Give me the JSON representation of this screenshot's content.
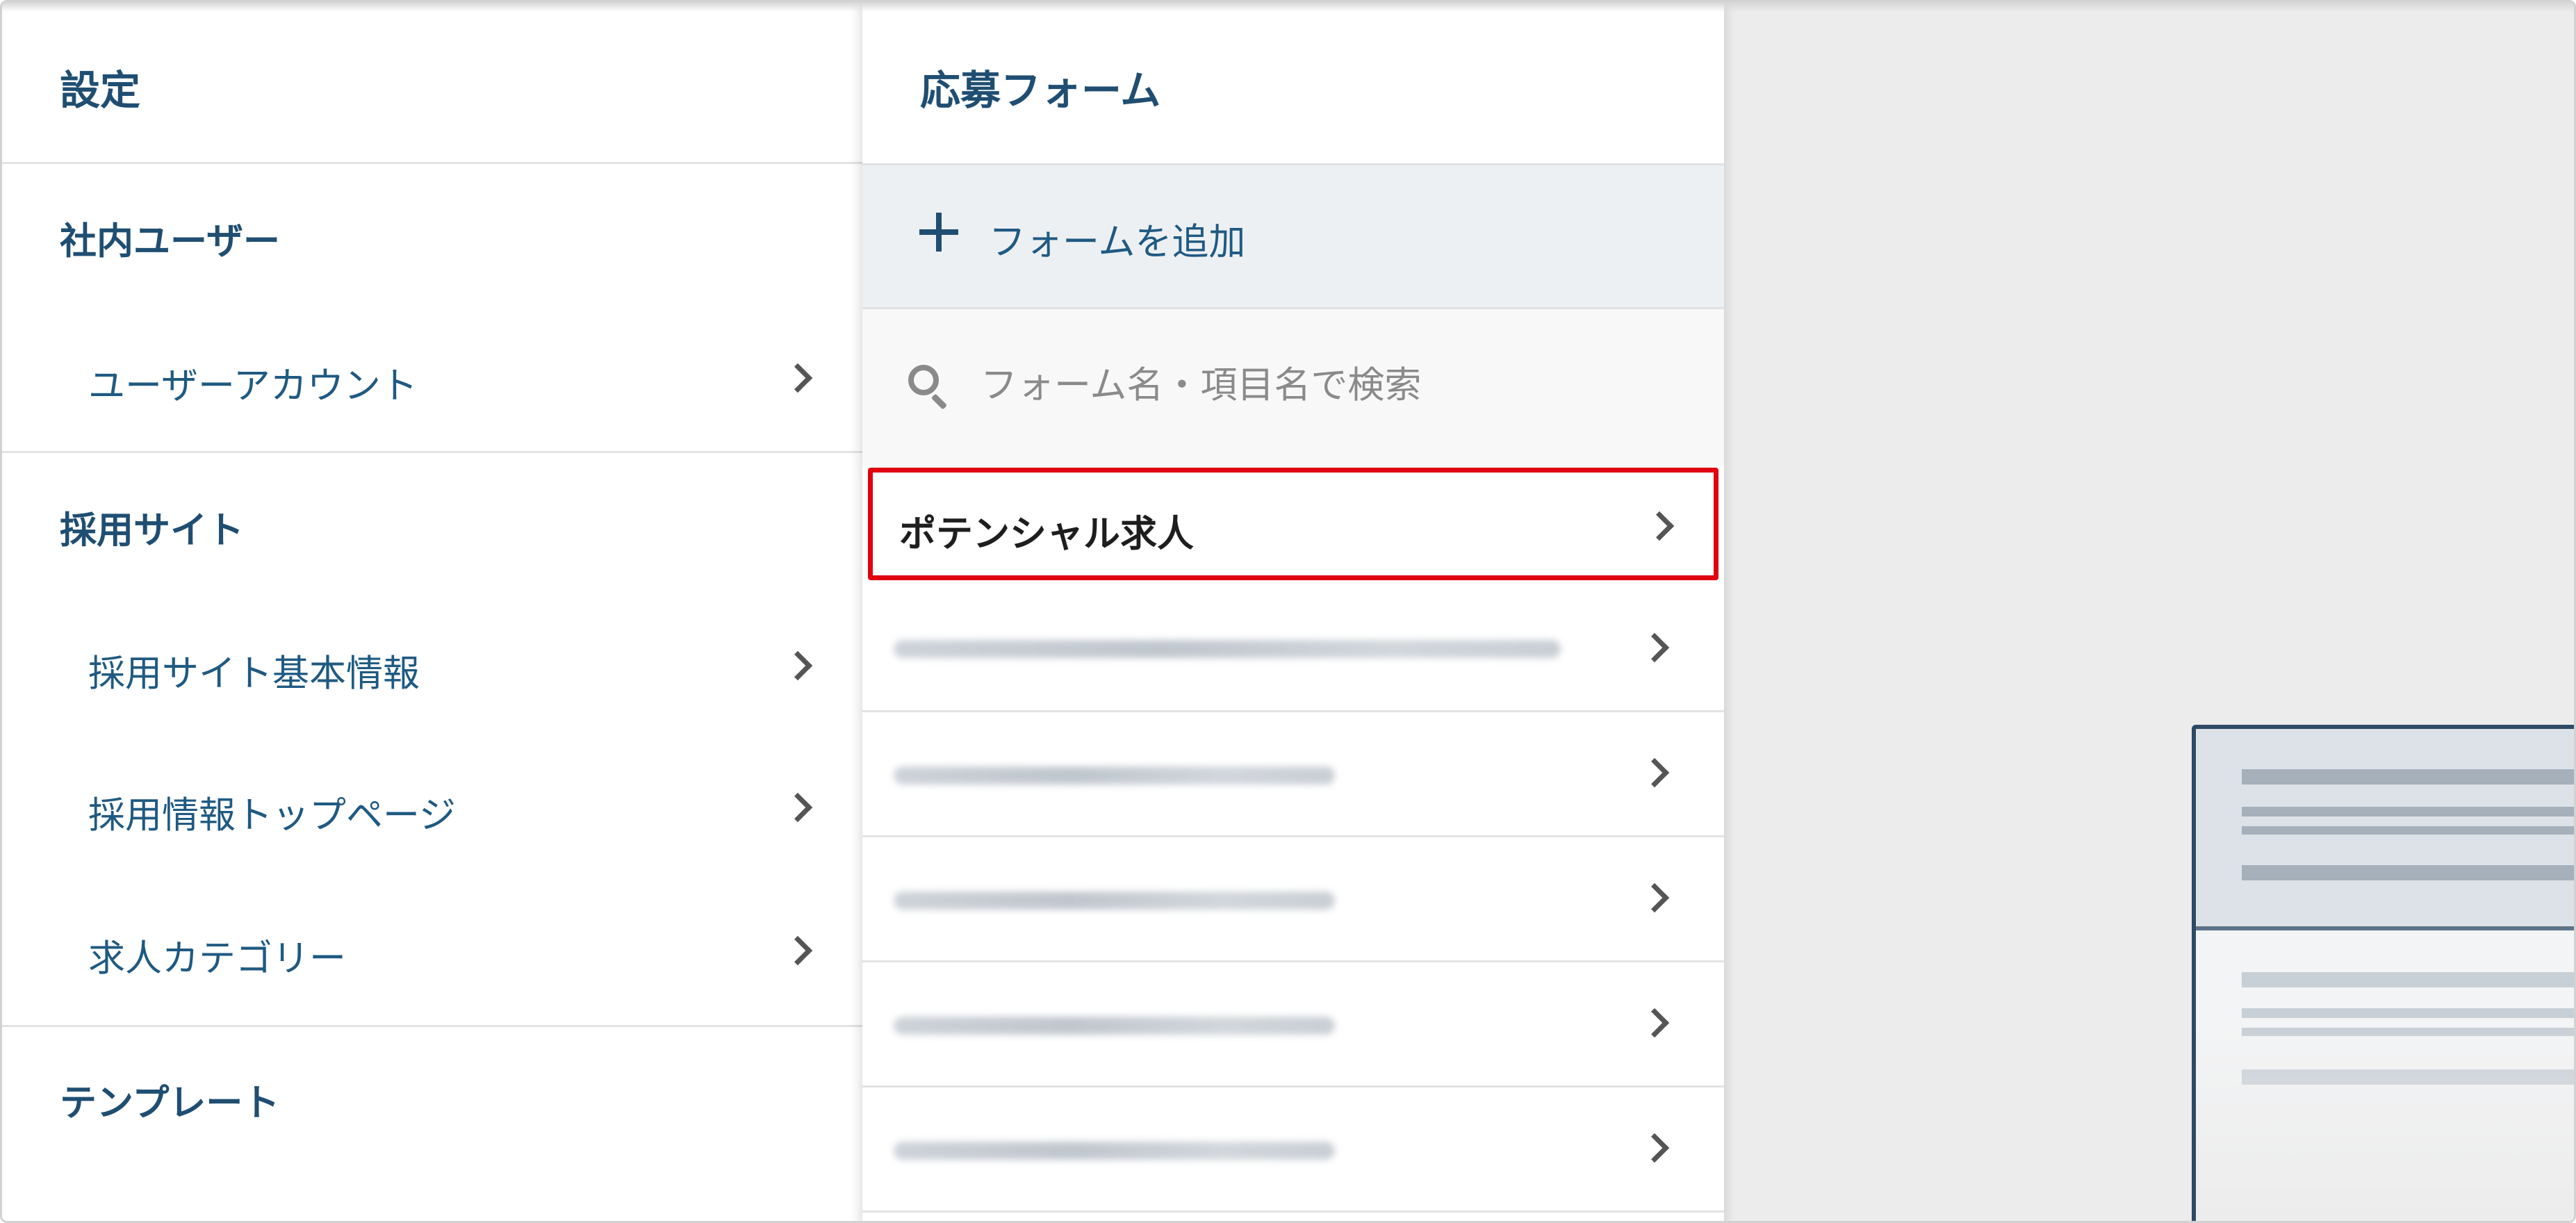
{
  "settings_panel": {
    "title": "設定",
    "sections": [
      {
        "label": "社内ユーザー",
        "items": [
          {
            "label": "ユーザーアカウント"
          }
        ]
      },
      {
        "label": "採用サイト",
        "items": [
          {
            "label": "採用サイト基本情報"
          },
          {
            "label": "採用情報トップページ"
          },
          {
            "label": "求人カテゴリー"
          }
        ]
      },
      {
        "label": "テンプレート",
        "items": []
      }
    ]
  },
  "form_panel": {
    "title": "応募フォーム",
    "add_label": "フォームを追加",
    "search": {
      "placeholder": "フォーム名・項目名で検索",
      "value": ""
    },
    "forms": [
      {
        "name": "ポテンシャル求人",
        "highlighted": true
      },
      {
        "name": "",
        "blurred": true
      },
      {
        "name": "",
        "blurred": true
      },
      {
        "name": "",
        "blurred": true
      },
      {
        "name": "",
        "blurred": true
      },
      {
        "name": "",
        "blurred": true
      }
    ]
  },
  "colors": {
    "heading": "#1f4e72",
    "highlight_border": "#e0000f",
    "add_row_bg": "#edf0f3",
    "preview_bg": "#ececec"
  },
  "icons": [
    "plus-icon",
    "search-icon",
    "chevron-right-icon"
  ]
}
